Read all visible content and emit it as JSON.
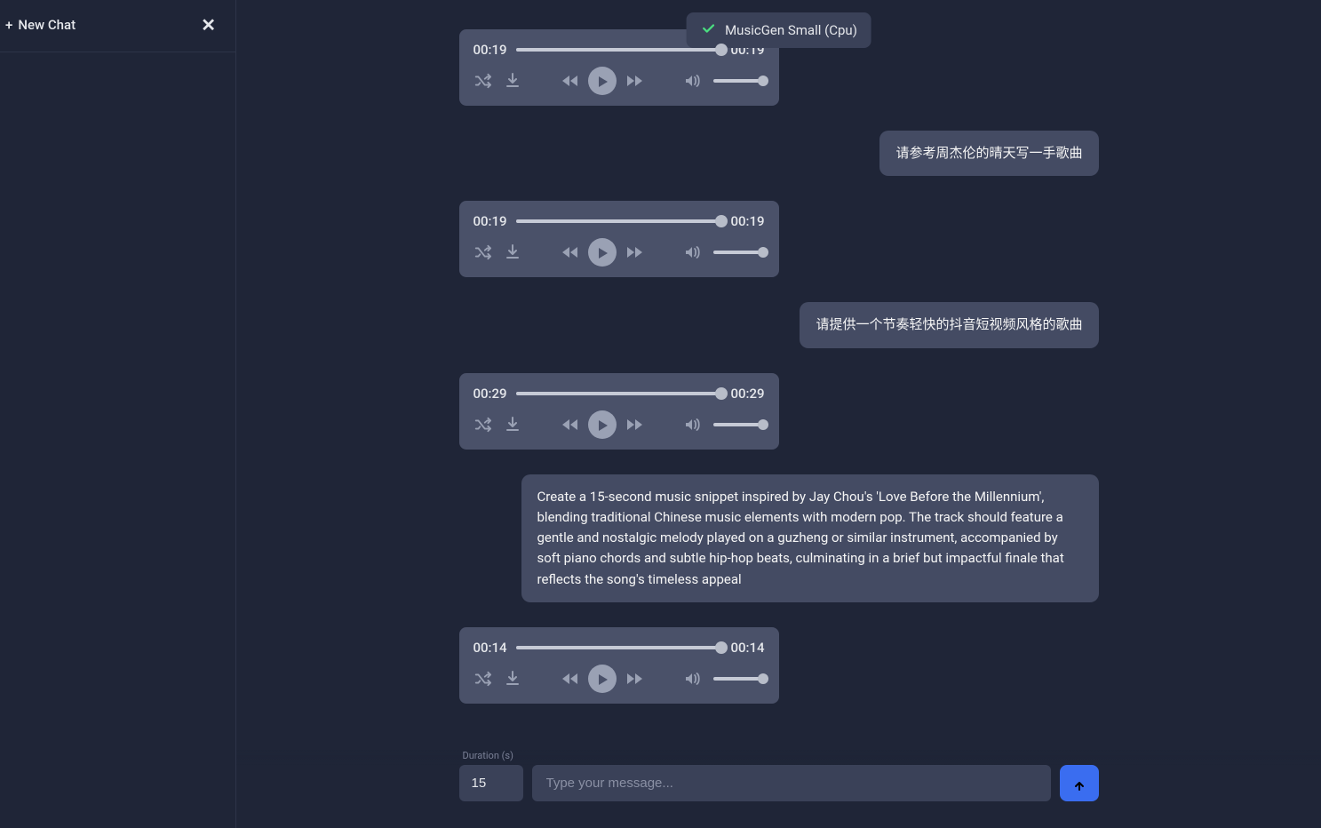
{
  "sidebar": {
    "new_chat_label": "New Chat",
    "plus": "+"
  },
  "model": {
    "label": "MusicGen Small (Cpu)"
  },
  "messages": {
    "user1": "请参考周杰伦的晴天写一手歌曲",
    "user2": "请提供一个节奏轻快的抖音短视频风格的歌曲",
    "user3": "Create a 15-second music snippet inspired by Jay Chou's 'Love Before the Millennium', blending traditional Chinese music elements with modern pop. The track should feature a gentle and nostalgic melody played on a guzheng or similar instrument, accompanied by soft piano chords and subtle hip-hop beats, culminating in a brief but impactful finale that reflects the song's timeless appeal"
  },
  "players": [
    {
      "current": "00:19",
      "total": "00:19",
      "progress": 100
    },
    {
      "current": "00:19",
      "total": "00:19",
      "progress": 100
    },
    {
      "current": "00:29",
      "total": "00:29",
      "progress": 100
    },
    {
      "current": "00:14",
      "total": "00:14",
      "progress": 100
    }
  ],
  "composer": {
    "duration_label": "Duration (s)",
    "duration_value": "15",
    "placeholder": "Type your message..."
  }
}
